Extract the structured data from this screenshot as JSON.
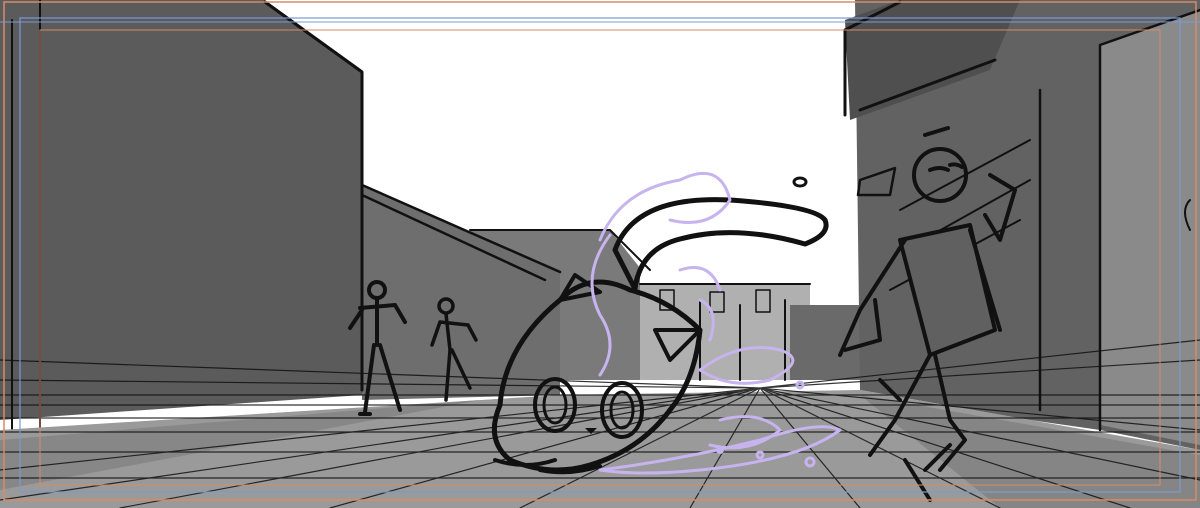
{
  "artwork": {
    "kind": "storyboard-sketch",
    "style": "grayscale rough sketch with perspective guide lines",
    "subjects": [
      "cat",
      "street",
      "buildings",
      "pedestrians",
      "running-person",
      "magic-swirl"
    ]
  },
  "colors": {
    "sky": "#ffffff",
    "building_dark": "#5b5b5b",
    "building_mid": "#6e6e6e",
    "building_light": "#8a8a8a",
    "street": "#9a9a9a",
    "sidewalk": "#878787",
    "ink": "#111111",
    "cat_body": "#545454",
    "magic": "#c7b3ee",
    "guide_frame_outer": "#d88a6a",
    "guide_frame_inner": "#7a9ad6"
  }
}
